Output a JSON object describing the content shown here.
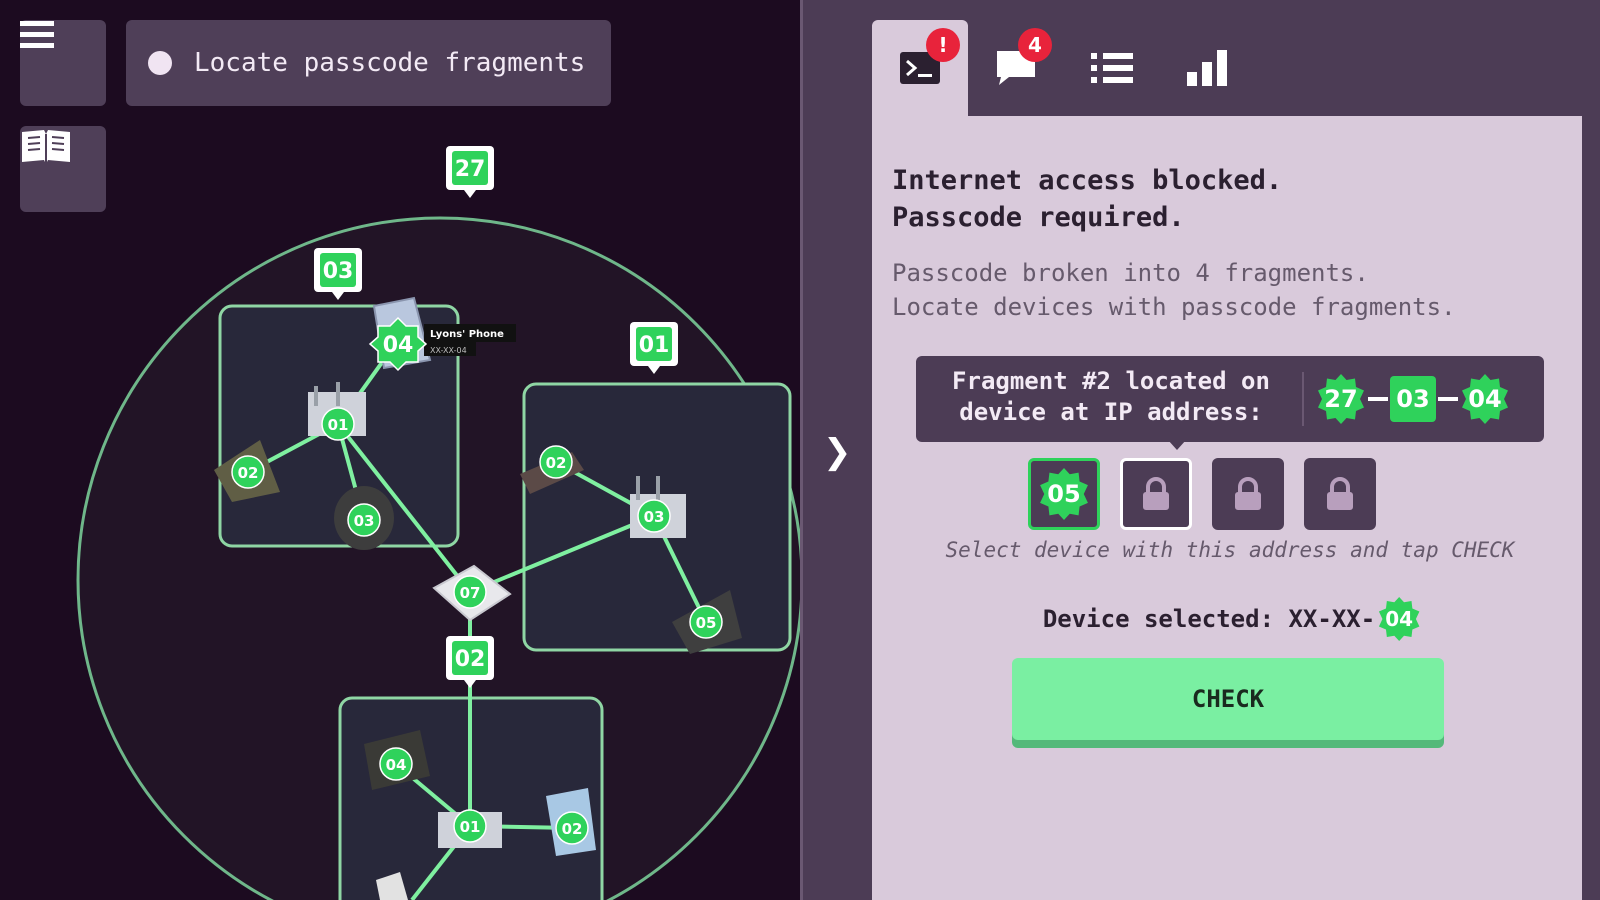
{
  "objective": {
    "text": "Locate passcode fragments"
  },
  "tabs": [
    {
      "name": "terminal",
      "badge": "!"
    },
    {
      "name": "messages",
      "badge": "4"
    },
    {
      "name": "list",
      "badge": ""
    },
    {
      "name": "stats",
      "badge": ""
    }
  ],
  "terminal": {
    "line1": "Internet access blocked.",
    "line2": "Passcode required.",
    "info1": "Passcode broken into 4 fragments.",
    "info2": "Locate devices with passcode fragments."
  },
  "fragment": {
    "label_line1": "Fragment #2 located on",
    "label_line2": "device at IP address:",
    "ip": [
      "27",
      "03",
      "04"
    ],
    "slots": [
      {
        "state": "unlocked",
        "value": "05"
      },
      {
        "state": "locked",
        "value": ""
      },
      {
        "state": "locked",
        "value": ""
      },
      {
        "state": "locked",
        "value": ""
      }
    ],
    "hint": "Select device with this address and tap CHECK",
    "selected_label": "Device selected: XX-XX-",
    "selected_value": "04"
  },
  "check_button": {
    "label": "CHECK"
  },
  "map": {
    "outer_tag": "27",
    "subnets": [
      {
        "tag": "03",
        "devices": [
          "04",
          "01",
          "02",
          "03"
        ]
      },
      {
        "tag": "01",
        "devices": [
          "02",
          "03",
          "05"
        ]
      },
      {
        "tag": "02",
        "devices": [
          "04",
          "01",
          "02"
        ]
      }
    ],
    "center_router": "07",
    "device_popup": {
      "name": "Lyons' Phone",
      "address": "XX-XX-04"
    }
  },
  "colors": {
    "accent_green": "#2fd25b",
    "check_button": "#7aefa2",
    "panel": "#d9cadb",
    "badge_red": "#e8233b"
  },
  "icons": [
    "menu-icon",
    "book-icon",
    "terminal-icon",
    "chat-icon",
    "list-icon",
    "bar-chart-icon",
    "lock-icon",
    "chevron-right-icon"
  ]
}
